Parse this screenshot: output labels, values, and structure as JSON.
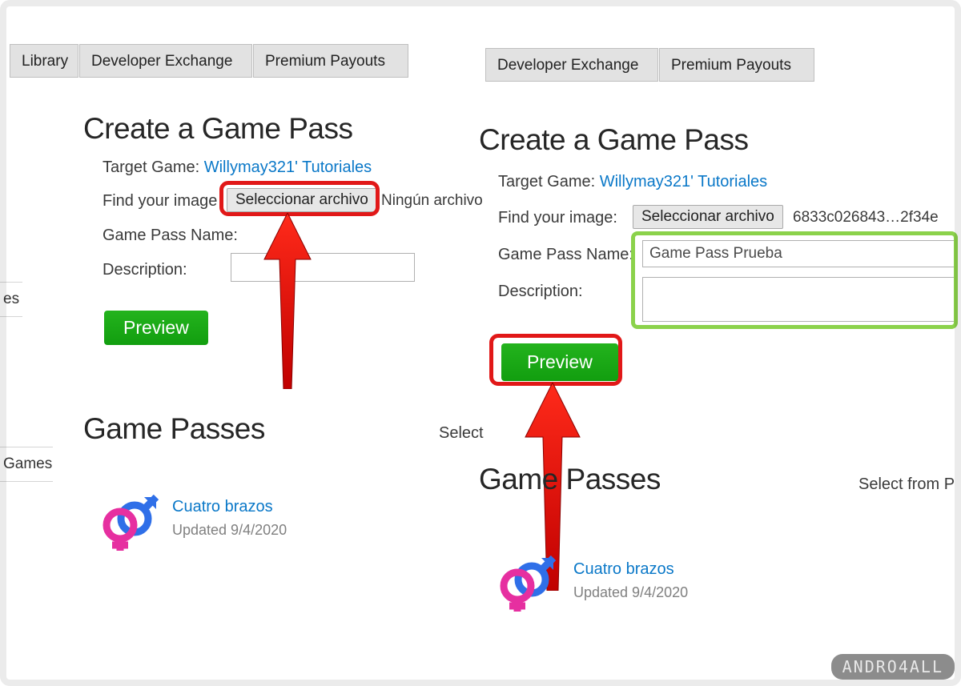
{
  "left": {
    "tabs": [
      "Library",
      "Developer Exchange",
      "Premium Payouts"
    ],
    "heading": "Create a Game Pass",
    "target_label": "Target Game:",
    "target_link": "Willymay321' Tutoriales",
    "find_label": "Find your image",
    "file_button": "Seleccionar archivo",
    "file_status": "Ningún archivo",
    "name_label": "Game Pass Name:",
    "desc_label": "Description:",
    "preview_button": "Preview",
    "passes_heading": "Game Passes",
    "select_label": "Select",
    "pass_name": "Cuatro brazos",
    "pass_updated": "Updated  9/4/2020"
  },
  "right": {
    "tabs": [
      "Developer Exchange",
      "Premium Payouts"
    ],
    "heading": "Create a Game Pass",
    "target_label": "Target Game:",
    "target_link": "Willymay321' Tutoriales",
    "find_label": "Find your image:",
    "file_button": "Seleccionar archivo",
    "file_status": "6833c026843…2f34e",
    "name_label": "Game Pass Name:",
    "name_value": "Game Pass Prueba",
    "desc_label": "Description:",
    "preview_button": "Preview",
    "passes_heading": "Game Passes",
    "select_label": "Select from P",
    "pass_name": "Cuatro brazos",
    "pass_updated": "Updated  9/4/2020"
  },
  "sidebar": {
    "frag1": "es",
    "frag2": "Games"
  },
  "watermark": "ANDRO4ALL"
}
